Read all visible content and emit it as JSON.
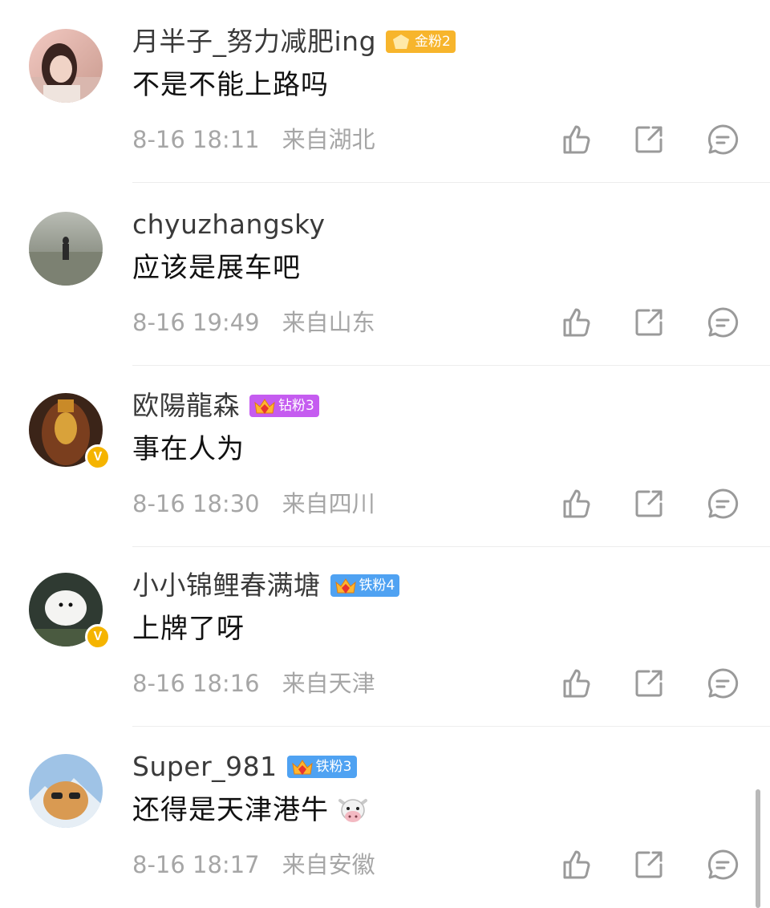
{
  "comments": [
    {
      "username": "月半子_努力减肥ing",
      "badge": {
        "label": "金粉2",
        "type": "gold"
      },
      "text": "不是不能上路吗",
      "time": "8-16 18:11",
      "location": "来自湖北",
      "verified": false,
      "avatar_desc": "woman-portrait"
    },
    {
      "username": "chyuzhangsky",
      "badge": null,
      "text": "应该是展车吧",
      "time": "8-16 19:49",
      "location": "来自山东",
      "verified": false,
      "avatar_desc": "lone-figure-landscape"
    },
    {
      "username": "欧陽龍森",
      "badge": {
        "label": "钻粉3",
        "type": "diamond"
      },
      "text": "事在人为",
      "time": "8-16 18:30",
      "location": "来自四川",
      "verified": true,
      "avatar_desc": "golden-buddha-statue"
    },
    {
      "username": "小小锦鲤春满塘",
      "badge": {
        "label": "铁粉4",
        "type": "iron"
      },
      "text": "上牌了呀",
      "time": "8-16 18:16",
      "location": "来自天津",
      "verified": true,
      "avatar_desc": "white-bird"
    },
    {
      "username": "Super_981",
      "badge": {
        "label": "铁粉3",
        "type": "iron"
      },
      "text": "还得是天津港牛",
      "emoji": "cow-face",
      "time": "8-16 18:17",
      "location": "来自安徽",
      "verified": false,
      "avatar_desc": "cat-with-sunglasses"
    }
  ],
  "icons": {
    "like": "thumbs-up-icon",
    "share": "share-icon",
    "reply": "comment-icon",
    "verified_badge": "V"
  },
  "colors": {
    "gold_badge": "#f7b52c",
    "diamond_badge": "#c55cf0",
    "iron_badge": "#4fa2f2",
    "verified": "#f5b400",
    "meta_text": "#a6a6a6"
  }
}
